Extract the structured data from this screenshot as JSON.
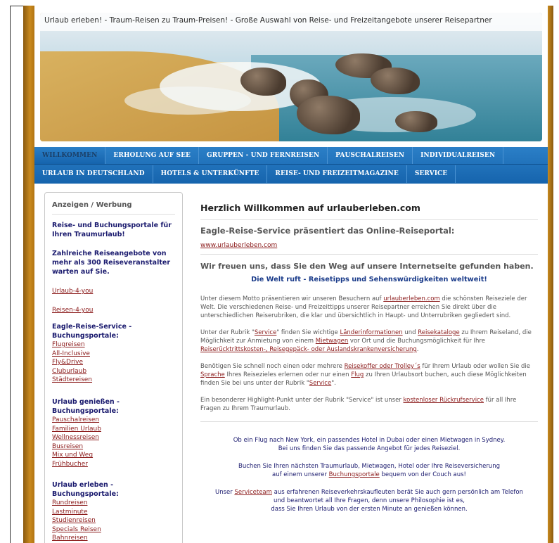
{
  "banner": {
    "text": "Urlaub erleben! - Traum-Reisen zu Traum-Preisen! - Große Auswahl von Reise- und Freizeitangebote unserer Reisepartner"
  },
  "nav": {
    "row1": [
      "WILLKOMMEN",
      "ERHOLUNG AUF SEE",
      "GRUPPEN - UND FERNREISEN",
      "PAUSCHALREISEN",
      "INDIVIDUALREISEN"
    ],
    "row2": [
      "URLAUB IN DEUTSCHLAND",
      "HOTELS & UNTERKÜNFTE",
      "REISE- UND FREIZEITMAGAZINE",
      "SERVICE"
    ]
  },
  "sidebar": {
    "heading": "Anzeigen / Werbung",
    "intro1": "Reise- und Buchungsportale für Ihren Traumurlaub!",
    "intro2": "Zahlreiche Reiseangebote von mehr als 300 Reiseveranstalter warten auf Sie.",
    "link1": "Urlaub-4-you",
    "link2": "Reisen-4-you",
    "group1": {
      "title": "Eagle-Reise-Service - Buchungsportale:",
      "links": [
        "Flugreisen",
        "All-Inclusive",
        "Fly&Drive",
        "Cluburlaub",
        "Städtereisen"
      ]
    },
    "group2": {
      "title": "Urlaub genießen - Buchungsportale:",
      "links": [
        "Pauschalreisen",
        "Familien Urlaub",
        "Wellnessreisen",
        "Busreisen",
        "Mix und Weg",
        "Frühbucher"
      ]
    },
    "group3": {
      "title": "Urlaub erleben - Buchungsportale:",
      "links": [
        "Rundreisen",
        "Lastminute",
        "Studienreisen",
        "Specials Reisen",
        "Bahnreisen"
      ]
    }
  },
  "main": {
    "title": "Herzlich Willkommen auf urlauberleben.com",
    "subtitle": "Eagle-Reise-Service präsentiert das Online-Reiseportal:",
    "url": "www.urlauberleben.com",
    "welcome": "Wir freuen uns, dass Sie den Weg auf unsere Internetseite gefunden haben.",
    "motto": "Die Welt ruft - Reisetipps und Sehenswürdigkeiten weltweit!",
    "p1": {
      "a": "Unter diesem Motto präsentieren wir unseren Besuchern auf ",
      "link": "urlauberleben.com",
      "b": " die schönsten Reiseziele der Welt. Die verschiedenen Reise- und Freizeittipps unserer Reisepartner erreichen Sie direkt über die unterschiedlichen Reiserubriken, die klar und übersichtlich in Haupt- und Unterrubriken gegliedert sind."
    },
    "p2": {
      "a": "Unter der Rubrik \"",
      "link1": "Service",
      "b": "\" finden Sie wichtige ",
      "link2": "Länderinformationen",
      "c": " und ",
      "link3": "Reisekataloge",
      "d": " zu Ihrem Reiseland, die Möglichkeit zur Anmietung von einem ",
      "link4": "Mietwagen",
      "e": " vor Ort und die Buchungsmöglichkeit für Ihre ",
      "link5": "Reiserücktrittskosten-, Reisegepäck- oder Auslandskrankenversicherung",
      "f": "."
    },
    "p3": {
      "a": "Benötigen Sie schnell noch einen oder mehrere ",
      "link1": "Reisekoffer oder Trolley´s",
      "b": " für Ihrem Urlaub oder wollen Sie die ",
      "link2": "Sprache",
      "c": " Ihres Reisezieles erlernen oder nur einen ",
      "link3": "Flug",
      "d": " zu Ihren Urlaubsort buchen, auch diese Möglichkeiten finden Sie bei uns unter der Rubrik \"",
      "link4": "Service",
      "e": "\"."
    },
    "p4": {
      "a": "Ein besonderer Highlight-Punkt unter der Rubrik \"Service\" ist unser ",
      "link": "kostenloser Rückrufservice",
      "b": " für all Ihre Fragen zu Ihrem Traumurlaub."
    },
    "c1": {
      "line1": "Ob ein Flug nach New York, ein passendes Hotel in Dubai oder einen Mietwagen in Sydney.",
      "line2": "Bei uns finden Sie das passende Angebot für jedes Reiseziel."
    },
    "c2": {
      "line1": "Buchen Sie Ihren nächsten Traumurlaub, Mietwagen, Hotel oder Ihre Reiseversicherung",
      "a": "auf einem unserer ",
      "link": "Buchungsportale",
      "b": " bequem von der Couch aus!"
    },
    "c3": {
      "a": "Unser ",
      "link": "Serviceteam",
      "b": " aus erfahrenen Reiseverkehrskaufleuten berät Sie auch gern persönlich am Telefon",
      "line2": "und beantwortet all Ihre Fragen, denn unsere Philosophie ist es,",
      "line3": "dass Sie Ihren Urlaub von der ersten Minute an genießen können."
    }
  }
}
